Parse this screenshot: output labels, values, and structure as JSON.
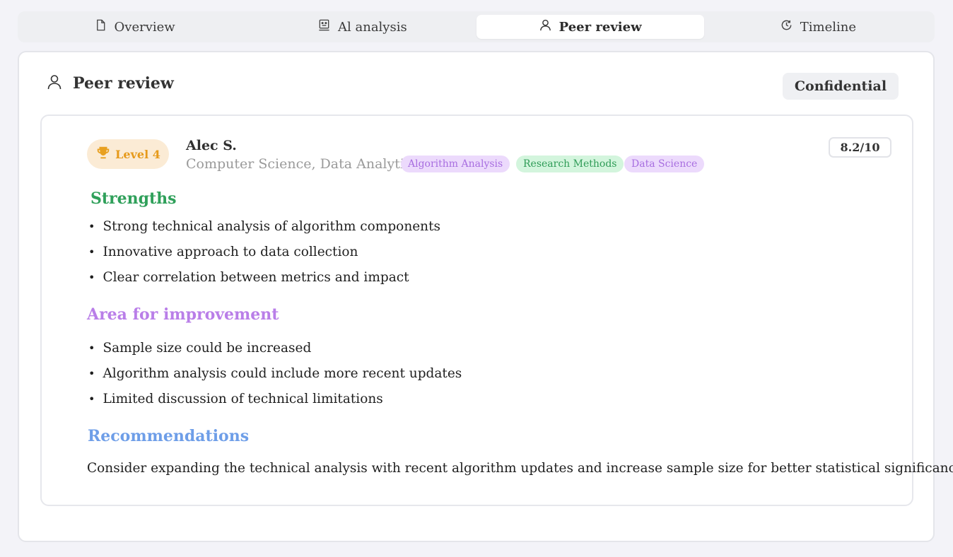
{
  "tabs": [
    {
      "label": "Overview",
      "icon": "document-icon",
      "active": false
    },
    {
      "label": "Al analysis",
      "icon": "robot-icon",
      "active": false
    },
    {
      "label": "Peer review",
      "icon": "user-icon",
      "active": true
    },
    {
      "label": "Timeline",
      "icon": "clock-history-icon",
      "active": false
    }
  ],
  "section": {
    "title": "Peer review",
    "icon": "user-icon",
    "badge": "Confidential"
  },
  "review": {
    "level_label": "Level 4",
    "level_icon": "trophy-icon",
    "reviewer_name": "Alec S.",
    "reviewer_field": "Computer Science, Data Analytics",
    "tags": [
      "Algorithm Analysis",
      "Research Methods",
      "Data Science"
    ],
    "score": "8.2/10",
    "strengths_heading": "Strengths",
    "strengths": [
      "Strong technical analysis of algorithm components",
      "Innovative approach to data collection",
      "Clear correlation between metrics and impact"
    ],
    "improvement_heading": "Area for improvement",
    "improvements": [
      "Sample size could be increased",
      "Algorithm analysis could include more recent updates",
      "Limited discussion of technical limitations"
    ],
    "recommendations_heading": "Recommendations",
    "recommendations": "Consider expanding the technical analysis with recent algorithm updates and increase sample size for better statistical significance."
  },
  "colors": {
    "strengths": "#2fa05a",
    "improvement": "#b97ee8",
    "recommendations": "#6e9ee8",
    "level": "#e69a1b"
  }
}
